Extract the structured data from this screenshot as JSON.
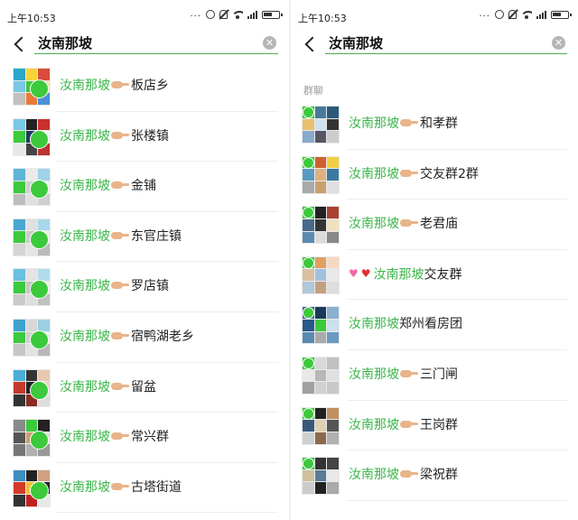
{
  "left": {
    "status": {
      "time": "上午10:53",
      "dots": "..."
    },
    "search": {
      "query": "汝南那坡"
    },
    "results": [
      {
        "keyword": "汝南那坡",
        "rest": "板店乡"
      },
      {
        "keyword": "汝南那坡",
        "rest": "张楼镇"
      },
      {
        "keyword": "汝南那坡",
        "rest": "金铺"
      },
      {
        "keyword": "汝南那坡",
        "rest": "东官庄镇"
      },
      {
        "keyword": "汝南那坡",
        "rest": "罗店镇"
      },
      {
        "keyword": "汝南那坡",
        "rest": "宿鸭湖老乡"
      },
      {
        "keyword": "汝南那坡",
        "rest": "留盆"
      },
      {
        "keyword": "汝南那坡",
        "rest": "常兴群"
      },
      {
        "keyword": "汝南那坡",
        "rest": "古塔街道"
      }
    ]
  },
  "right": {
    "status": {
      "time": "上午10:53",
      "dots": "..."
    },
    "search": {
      "query": "汝南那坡"
    },
    "section_label": "群聊",
    "results": [
      {
        "keyword": "汝南那坡",
        "rest": "和孝群"
      },
      {
        "keyword": "汝南那坡",
        "rest": "交友群2群"
      },
      {
        "keyword": "汝南那坡",
        "rest": "老君庙"
      },
      {
        "keyword": "汝南那坡",
        "rest": "交友群"
      },
      {
        "keyword": "汝南那坡",
        "rest": "郑州看房团"
      },
      {
        "keyword": "汝南那坡",
        "rest": "三门闸"
      },
      {
        "keyword": "汝南那坡",
        "rest": "王岗群"
      },
      {
        "keyword": "汝南那坡",
        "rest": "梁祝群"
      }
    ]
  },
  "colors": {
    "keyword_highlight": "#3bb64a",
    "search_underline": "#4caf50",
    "avatar_badge": "#3cc93c",
    "section_label": "#9a9a9a"
  },
  "icons": {
    "back": "chevron-left-icon",
    "clear": "clear-circle-icon",
    "pointing_hand": "backhand-index-pointing-right-emoji",
    "hearts": [
      "growing-heart-emoji",
      "red-heart-emoji"
    ]
  }
}
